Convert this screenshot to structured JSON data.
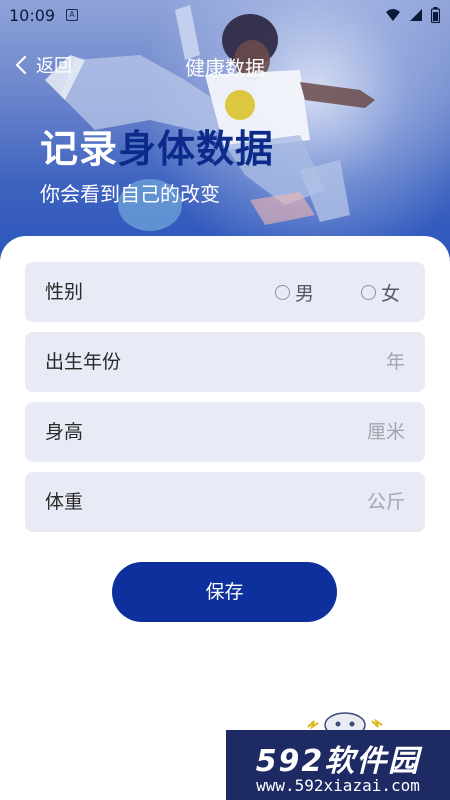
{
  "status_bar": {
    "time": "10:09",
    "notification_badge": "A"
  },
  "nav": {
    "back_label": "返回",
    "title": "健康数据"
  },
  "hero": {
    "headline_part1": "记录",
    "headline_part2": "身体数据",
    "subtitle": "你会看到自己的改变"
  },
  "form": {
    "gender": {
      "label": "性别",
      "options": [
        "男",
        "女"
      ]
    },
    "birth_year": {
      "label": "出生年份",
      "unit": "年"
    },
    "height": {
      "label": "身高",
      "unit": "厘米"
    },
    "weight": {
      "label": "体重",
      "unit": "公斤"
    },
    "save_label": "保存"
  },
  "watermark": {
    "brand": "592软件园",
    "url": "www.592xiazai.com"
  },
  "colors": {
    "primary": "#0e309d",
    "field_bg": "#e8ebf5",
    "headline_accent": "#0b2a8a"
  }
}
